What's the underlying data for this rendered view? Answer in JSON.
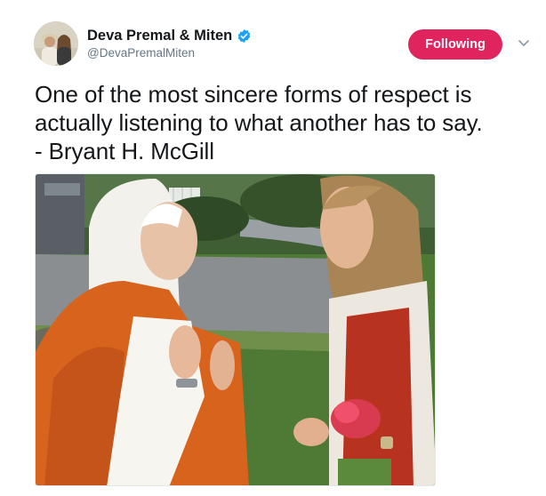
{
  "user": {
    "display_name": "Deva Premal & Miten",
    "handle": "@DevaPremalMiten",
    "verified": true,
    "avatar_icon": "avatar-photo"
  },
  "actions": {
    "follow_label": "Following",
    "follow_color": "#e0245e",
    "menu_icon": "chevron-down-icon"
  },
  "tweet": {
    "lines": [
      "One of the most sincere forms of respect is",
      "actually listening to what another has to say.",
      "- Bryant H. McGill"
    ]
  },
  "media": {
    "type": "photo",
    "verified_color": "#1da1f2"
  }
}
